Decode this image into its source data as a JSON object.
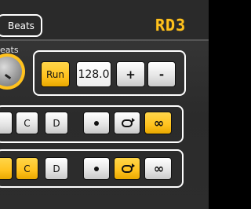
{
  "header": {
    "tab_label": "Beats",
    "logo": "RD3"
  },
  "beats_section": {
    "label": "eats"
  },
  "tempo": {
    "run_label": "Run",
    "bpm_value": "128.0",
    "plus_label": "+",
    "minus_label": "-"
  },
  "row1": {
    "c_label": "C",
    "d_label": "D",
    "icons": [
      "dot-icon",
      "loop-icon",
      "infinity-icon"
    ]
  },
  "row2": {
    "c_label": "C",
    "d_label": "D",
    "icons": [
      "dot-icon",
      "loop-icon",
      "infinity-icon"
    ]
  },
  "colors": {
    "accent": "#ffc21e",
    "background": "#2f2f2f",
    "button_white": "#ececec"
  }
}
